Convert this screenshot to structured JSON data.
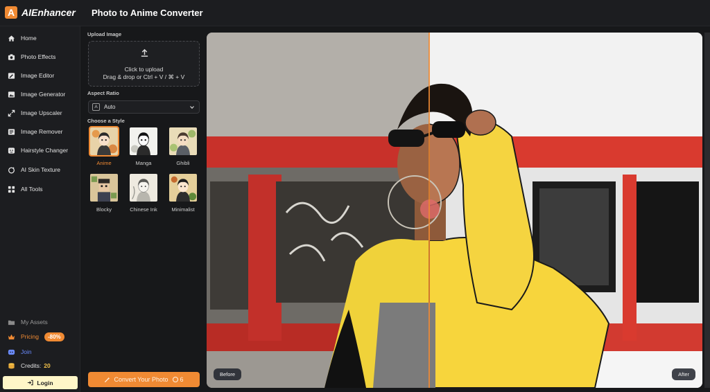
{
  "app": {
    "logo_letter": "A",
    "name": "AIEnhancer",
    "page_title": "Photo to Anime Converter",
    "accent": "#f08a33"
  },
  "nav": {
    "items": [
      {
        "label": "Home",
        "icon": "home-icon"
      },
      {
        "label": "Photo Effects",
        "icon": "camera-icon"
      },
      {
        "label": "Image Editor",
        "icon": "image-edit-icon"
      },
      {
        "label": "Image Generator",
        "icon": "image-generate-icon"
      },
      {
        "label": "Image Upscaler",
        "icon": "expand-icon"
      },
      {
        "label": "Image Remover",
        "icon": "image-remove-icon"
      },
      {
        "label": "Hairstyle Changer",
        "icon": "face-icon"
      },
      {
        "label": "AI Skin Texture",
        "icon": "sparkle-icon"
      },
      {
        "label": "All Tools",
        "icon": "grid-icon"
      }
    ],
    "bottom": {
      "assets": "My Assets",
      "pricing": "Pricing",
      "pricing_badge": "-80%",
      "join": "Join",
      "credits_label": "Credits:",
      "credits_value": "20",
      "login": "Login"
    }
  },
  "panel": {
    "upload_label": "Upload Image",
    "upload_title": "Click to upload",
    "upload_hint": "Drag & drop or Ctrl + V / ⌘ + V",
    "aspect_label": "Aspect Ratio",
    "aspect_badge": "A",
    "aspect_value": "Auto",
    "style_label": "Choose a Style",
    "styles": [
      {
        "name": "Anime",
        "selected": true
      },
      {
        "name": "Manga",
        "selected": false
      },
      {
        "name": "Ghibli",
        "selected": false
      },
      {
        "name": "Blocky",
        "selected": false
      },
      {
        "name": "Chinese Ink",
        "selected": false
      },
      {
        "name": "Minimalist",
        "selected": false
      }
    ],
    "convert_label": "Convert Your Photo",
    "convert_cost": "6"
  },
  "preview": {
    "before_label": "Before",
    "after_label": "After"
  }
}
